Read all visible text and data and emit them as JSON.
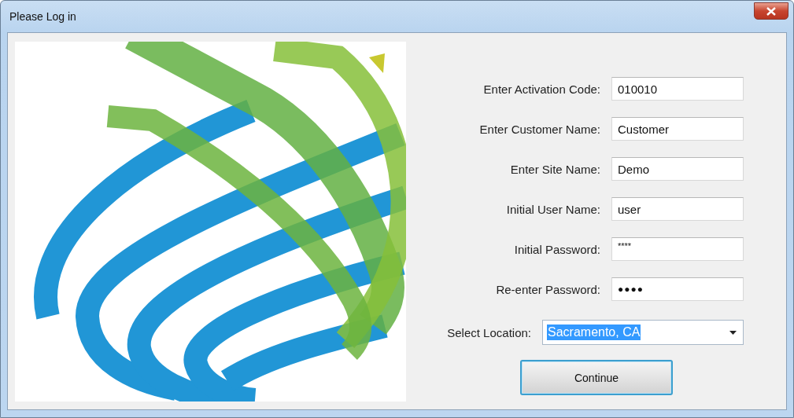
{
  "window": {
    "title": "Please Log in"
  },
  "fields": [
    {
      "label": "Enter Activation Code:",
      "value": "010010"
    },
    {
      "label": "Enter Customer Name:",
      "value": "Customer"
    },
    {
      "label": "Enter Site Name:",
      "value": "Demo"
    },
    {
      "label": "Initial User Name:",
      "value": "user"
    },
    {
      "label": "Initial Password:",
      "value": "****",
      "kind": "small"
    },
    {
      "label": "Re-enter Password:",
      "value": "●●●●",
      "kind": "dots"
    }
  ],
  "location": {
    "label": "Select Location:",
    "value": "Sacramento, CA",
    "highlighted": true
  },
  "continue_button": {
    "label": "Continue",
    "focused": true
  }
}
